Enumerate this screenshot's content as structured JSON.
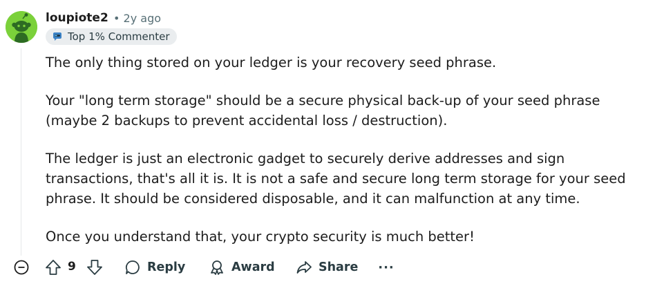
{
  "comment": {
    "author": "loupiote2",
    "separator_time": "• 2y ago",
    "flair": "Top 1% Commenter",
    "avatar_color": "#7bd13a",
    "paragraphs": [
      "The only thing stored on your ledger is your recovery seed phrase.",
      "Your \"long term storage\" should be a secure physical back-up of your seed phrase (maybe 2 backups to prevent accidental loss / destruction).",
      "The ledger is just an electronic gadget to securely derive addresses and sign transactions, that's all it is. It is not a safe and secure long term storage for your seed phrase. It should be considered disposable, and it can malfunction at any time.",
      "Once you understand that, your crypto security is much better!"
    ]
  },
  "actions": {
    "vote_count": "9",
    "reply_label": "Reply",
    "award_label": "Award",
    "share_label": "Share",
    "more_label": "···"
  },
  "icons": {
    "collapse": "collapse-minus-icon",
    "upvote": "upvote-arrow-icon",
    "downvote": "downvote-arrow-icon",
    "reply": "speech-bubble-icon",
    "award": "award-icon",
    "share": "share-arrow-icon",
    "flair": "commenter-badge-icon"
  },
  "colors": {
    "text": "#1c1c1c",
    "meta": "#576f76",
    "flair_bg": "#eaedef",
    "action": "#2a3c42"
  }
}
